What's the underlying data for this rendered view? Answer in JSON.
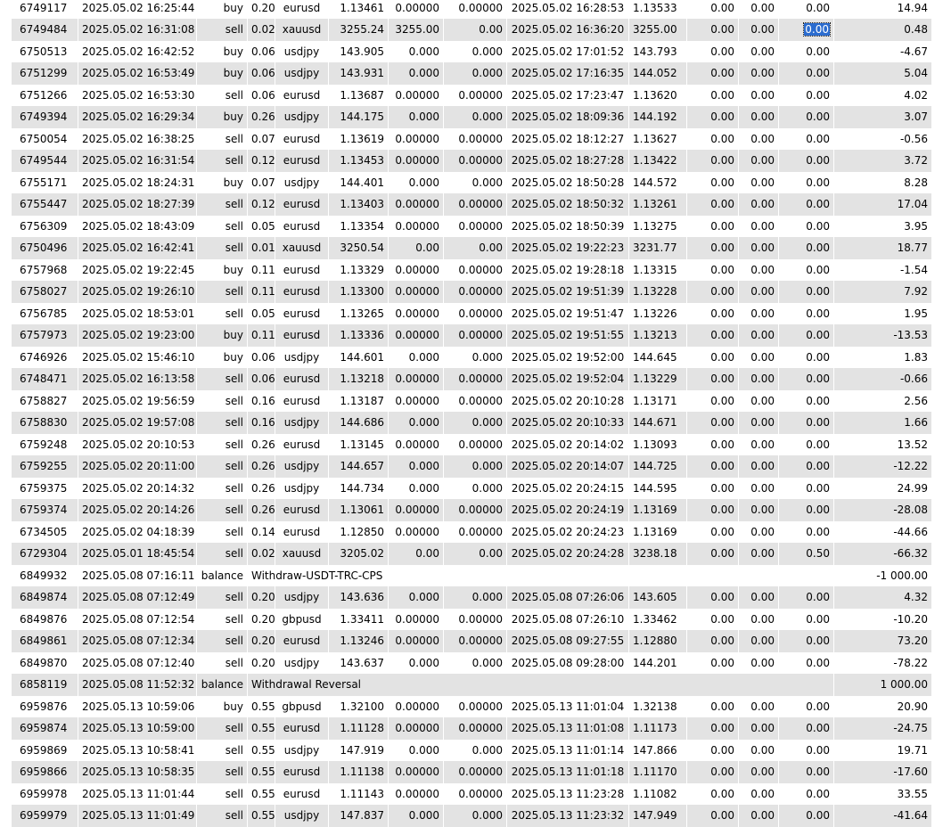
{
  "trade_rows": [
    {
      "ticket": "6749117",
      "open_time": "2025.05.02 16:25:44",
      "type": "buy",
      "size": "0.20",
      "symbol": "eurusd",
      "open_price": "1.13461",
      "sl": "0.00000",
      "tp": "0.00000",
      "close_time": "2025.05.02 16:28:53",
      "close_price": "1.13533",
      "commission": "0.00",
      "taxes": "0.00",
      "swap": "0.00",
      "profit": "14.94"
    },
    {
      "ticket": "6749484",
      "open_time": "2025.05.02 16:31:08",
      "type": "sell",
      "size": "0.02",
      "symbol": "xauusd",
      "open_price": "3255.24",
      "sl": "3255.00",
      "tp": "0.00",
      "close_time": "2025.05.02 16:36:20",
      "close_price": "3255.00",
      "commission": "0.00",
      "taxes": "0.00",
      "swap": "0.00",
      "profit": "0.48",
      "selected": true
    },
    {
      "ticket": "6750513",
      "open_time": "2025.05.02 16:42:52",
      "type": "buy",
      "size": "0.06",
      "symbol": "usdjpy",
      "open_price": "143.905",
      "sl": "0.000",
      "tp": "0.000",
      "close_time": "2025.05.02 17:01:52",
      "close_price": "143.793",
      "commission": "0.00",
      "taxes": "0.00",
      "swap": "0.00",
      "profit": "-4.67"
    },
    {
      "ticket": "6751299",
      "open_time": "2025.05.02 16:53:49",
      "type": "buy",
      "size": "0.06",
      "symbol": "usdjpy",
      "open_price": "143.931",
      "sl": "0.000",
      "tp": "0.000",
      "close_time": "2025.05.02 17:16:35",
      "close_price": "144.052",
      "commission": "0.00",
      "taxes": "0.00",
      "swap": "0.00",
      "profit": "5.04"
    },
    {
      "ticket": "6751266",
      "open_time": "2025.05.02 16:53:30",
      "type": "sell",
      "size": "0.06",
      "symbol": "eurusd",
      "open_price": "1.13687",
      "sl": "0.00000",
      "tp": "0.00000",
      "close_time": "2025.05.02 17:23:47",
      "close_price": "1.13620",
      "commission": "0.00",
      "taxes": "0.00",
      "swap": "0.00",
      "profit": "4.02"
    },
    {
      "ticket": "6749394",
      "open_time": "2025.05.02 16:29:34",
      "type": "buy",
      "size": "0.26",
      "symbol": "usdjpy",
      "open_price": "144.175",
      "sl": "0.000",
      "tp": "0.000",
      "close_time": "2025.05.02 18:09:36",
      "close_price": "144.192",
      "commission": "0.00",
      "taxes": "0.00",
      "swap": "0.00",
      "profit": "3.07"
    },
    {
      "ticket": "6750054",
      "open_time": "2025.05.02 16:38:25",
      "type": "sell",
      "size": "0.07",
      "symbol": "eurusd",
      "open_price": "1.13619",
      "sl": "0.00000",
      "tp": "0.00000",
      "close_time": "2025.05.02 18:12:27",
      "close_price": "1.13627",
      "commission": "0.00",
      "taxes": "0.00",
      "swap": "0.00",
      "profit": "-0.56"
    },
    {
      "ticket": "6749544",
      "open_time": "2025.05.02 16:31:54",
      "type": "sell",
      "size": "0.12",
      "symbol": "eurusd",
      "open_price": "1.13453",
      "sl": "0.00000",
      "tp": "0.00000",
      "close_time": "2025.05.02 18:27:28",
      "close_price": "1.13422",
      "commission": "0.00",
      "taxes": "0.00",
      "swap": "0.00",
      "profit": "3.72"
    },
    {
      "ticket": "6755171",
      "open_time": "2025.05.02 18:24:31",
      "type": "buy",
      "size": "0.07",
      "symbol": "usdjpy",
      "open_price": "144.401",
      "sl": "0.000",
      "tp": "0.000",
      "close_time": "2025.05.02 18:50:28",
      "close_price": "144.572",
      "commission": "0.00",
      "taxes": "0.00",
      "swap": "0.00",
      "profit": "8.28"
    },
    {
      "ticket": "6755447",
      "open_time": "2025.05.02 18:27:39",
      "type": "sell",
      "size": "0.12",
      "symbol": "eurusd",
      "open_price": "1.13403",
      "sl": "0.00000",
      "tp": "0.00000",
      "close_time": "2025.05.02 18:50:32",
      "close_price": "1.13261",
      "commission": "0.00",
      "taxes": "0.00",
      "swap": "0.00",
      "profit": "17.04"
    },
    {
      "ticket": "6756309",
      "open_time": "2025.05.02 18:43:09",
      "type": "sell",
      "size": "0.05",
      "symbol": "eurusd",
      "open_price": "1.13354",
      "sl": "0.00000",
      "tp": "0.00000",
      "close_time": "2025.05.02 18:50:39",
      "close_price": "1.13275",
      "commission": "0.00",
      "taxes": "0.00",
      "swap": "0.00",
      "profit": "3.95"
    },
    {
      "ticket": "6750496",
      "open_time": "2025.05.02 16:42:41",
      "type": "sell",
      "size": "0.01",
      "symbol": "xauusd",
      "open_price": "3250.54",
      "sl": "0.00",
      "tp": "0.00",
      "close_time": "2025.05.02 19:22:23",
      "close_price": "3231.77",
      "commission": "0.00",
      "taxes": "0.00",
      "swap": "0.00",
      "profit": "18.77"
    },
    {
      "ticket": "6757968",
      "open_time": "2025.05.02 19:22:45",
      "type": "buy",
      "size": "0.11",
      "symbol": "eurusd",
      "open_price": "1.13329",
      "sl": "0.00000",
      "tp": "0.00000",
      "close_time": "2025.05.02 19:28:18",
      "close_price": "1.13315",
      "commission": "0.00",
      "taxes": "0.00",
      "swap": "0.00",
      "profit": "-1.54"
    },
    {
      "ticket": "6758027",
      "open_time": "2025.05.02 19:26:10",
      "type": "sell",
      "size": "0.11",
      "symbol": "eurusd",
      "open_price": "1.13300",
      "sl": "0.00000",
      "tp": "0.00000",
      "close_time": "2025.05.02 19:51:39",
      "close_price": "1.13228",
      "commission": "0.00",
      "taxes": "0.00",
      "swap": "0.00",
      "profit": "7.92"
    },
    {
      "ticket": "6756785",
      "open_time": "2025.05.02 18:53:01",
      "type": "sell",
      "size": "0.05",
      "symbol": "eurusd",
      "open_price": "1.13265",
      "sl": "0.00000",
      "tp": "0.00000",
      "close_time": "2025.05.02 19:51:47",
      "close_price": "1.13226",
      "commission": "0.00",
      "taxes": "0.00",
      "swap": "0.00",
      "profit": "1.95"
    },
    {
      "ticket": "6757973",
      "open_time": "2025.05.02 19:23:00",
      "type": "buy",
      "size": "0.11",
      "symbol": "eurusd",
      "open_price": "1.13336",
      "sl": "0.00000",
      "tp": "0.00000",
      "close_time": "2025.05.02 19:51:55",
      "close_price": "1.13213",
      "commission": "0.00",
      "taxes": "0.00",
      "swap": "0.00",
      "profit": "-13.53"
    },
    {
      "ticket": "6746926",
      "open_time": "2025.05.02 15:46:10",
      "type": "buy",
      "size": "0.06",
      "symbol": "usdjpy",
      "open_price": "144.601",
      "sl": "0.000",
      "tp": "0.000",
      "close_time": "2025.05.02 19:52:00",
      "close_price": "144.645",
      "commission": "0.00",
      "taxes": "0.00",
      "swap": "0.00",
      "profit": "1.83"
    },
    {
      "ticket": "6748471",
      "open_time": "2025.05.02 16:13:58",
      "type": "sell",
      "size": "0.06",
      "symbol": "eurusd",
      "open_price": "1.13218",
      "sl": "0.00000",
      "tp": "0.00000",
      "close_time": "2025.05.02 19:52:04",
      "close_price": "1.13229",
      "commission": "0.00",
      "taxes": "0.00",
      "swap": "0.00",
      "profit": "-0.66"
    },
    {
      "ticket": "6758827",
      "open_time": "2025.05.02 19:56:59",
      "type": "sell",
      "size": "0.16",
      "symbol": "eurusd",
      "open_price": "1.13187",
      "sl": "0.00000",
      "tp": "0.00000",
      "close_time": "2025.05.02 20:10:28",
      "close_price": "1.13171",
      "commission": "0.00",
      "taxes": "0.00",
      "swap": "0.00",
      "profit": "2.56"
    },
    {
      "ticket": "6758830",
      "open_time": "2025.05.02 19:57:08",
      "type": "sell",
      "size": "0.16",
      "symbol": "usdjpy",
      "open_price": "144.686",
      "sl": "0.000",
      "tp": "0.000",
      "close_time": "2025.05.02 20:10:33",
      "close_price": "144.671",
      "commission": "0.00",
      "taxes": "0.00",
      "swap": "0.00",
      "profit": "1.66"
    },
    {
      "ticket": "6759248",
      "open_time": "2025.05.02 20:10:53",
      "type": "sell",
      "size": "0.26",
      "symbol": "eurusd",
      "open_price": "1.13145",
      "sl": "0.00000",
      "tp": "0.00000",
      "close_time": "2025.05.02 20:14:02",
      "close_price": "1.13093",
      "commission": "0.00",
      "taxes": "0.00",
      "swap": "0.00",
      "profit": "13.52"
    },
    {
      "ticket": "6759255",
      "open_time": "2025.05.02 20:11:00",
      "type": "sell",
      "size": "0.26",
      "symbol": "usdjpy",
      "open_price": "144.657",
      "sl": "0.000",
      "tp": "0.000",
      "close_time": "2025.05.02 20:14:07",
      "close_price": "144.725",
      "commission": "0.00",
      "taxes": "0.00",
      "swap": "0.00",
      "profit": "-12.22"
    },
    {
      "ticket": "6759375",
      "open_time": "2025.05.02 20:14:32",
      "type": "sell",
      "size": "0.26",
      "symbol": "usdjpy",
      "open_price": "144.734",
      "sl": "0.000",
      "tp": "0.000",
      "close_time": "2025.05.02 20:24:15",
      "close_price": "144.595",
      "commission": "0.00",
      "taxes": "0.00",
      "swap": "0.00",
      "profit": "24.99"
    },
    {
      "ticket": "6759374",
      "open_time": "2025.05.02 20:14:26",
      "type": "sell",
      "size": "0.26",
      "symbol": "eurusd",
      "open_price": "1.13061",
      "sl": "0.00000",
      "tp": "0.00000",
      "close_time": "2025.05.02 20:24:19",
      "close_price": "1.13169",
      "commission": "0.00",
      "taxes": "0.00",
      "swap": "0.00",
      "profit": "-28.08"
    },
    {
      "ticket": "6734505",
      "open_time": "2025.05.02 04:18:39",
      "type": "sell",
      "size": "0.14",
      "symbol": "eurusd",
      "open_price": "1.12850",
      "sl": "0.00000",
      "tp": "0.00000",
      "close_time": "2025.05.02 20:24:23",
      "close_price": "1.13169",
      "commission": "0.00",
      "taxes": "0.00",
      "swap": "0.00",
      "profit": "-44.66"
    },
    {
      "ticket": "6729304",
      "open_time": "2025.05.01 18:45:54",
      "type": "sell",
      "size": "0.02",
      "symbol": "xauusd",
      "open_price": "3205.02",
      "sl": "0.00",
      "tp": "0.00",
      "close_time": "2025.05.02 20:24:28",
      "close_price": "3238.18",
      "commission": "0.00",
      "taxes": "0.00",
      "swap": "0.50",
      "profit": "-66.32"
    },
    {
      "ticket": "6849932",
      "open_time": "2025.05.08 07:16:11",
      "type": "balance",
      "comment": "Withdraw-USDT-TRC-CPS",
      "profit": "-1 000.00"
    },
    {
      "ticket": "6849874",
      "open_time": "2025.05.08 07:12:49",
      "type": "sell",
      "size": "0.20",
      "symbol": "usdjpy",
      "open_price": "143.636",
      "sl": "0.000",
      "tp": "0.000",
      "close_time": "2025.05.08 07:26:06",
      "close_price": "143.605",
      "commission": "0.00",
      "taxes": "0.00",
      "swap": "0.00",
      "profit": "4.32"
    },
    {
      "ticket": "6849876",
      "open_time": "2025.05.08 07:12:54",
      "type": "sell",
      "size": "0.20",
      "symbol": "gbpusd",
      "open_price": "1.33411",
      "sl": "0.00000",
      "tp": "0.00000",
      "close_time": "2025.05.08 07:26:10",
      "close_price": "1.33462",
      "commission": "0.00",
      "taxes": "0.00",
      "swap": "0.00",
      "profit": "-10.20"
    },
    {
      "ticket": "6849861",
      "open_time": "2025.05.08 07:12:34",
      "type": "sell",
      "size": "0.20",
      "symbol": "eurusd",
      "open_price": "1.13246",
      "sl": "0.00000",
      "tp": "0.00000",
      "close_time": "2025.05.08 09:27:55",
      "close_price": "1.12880",
      "commission": "0.00",
      "taxes": "0.00",
      "swap": "0.00",
      "profit": "73.20"
    },
    {
      "ticket": "6849870",
      "open_time": "2025.05.08 07:12:40",
      "type": "sell",
      "size": "0.20",
      "symbol": "usdjpy",
      "open_price": "143.637",
      "sl": "0.000",
      "tp": "0.000",
      "close_time": "2025.05.08 09:28:00",
      "close_price": "144.201",
      "commission": "0.00",
      "taxes": "0.00",
      "swap": "0.00",
      "profit": "-78.22"
    },
    {
      "ticket": "6858119",
      "open_time": "2025.05.08 11:52:32",
      "type": "balance",
      "comment": "Withdrawal Reversal",
      "profit": "1 000.00"
    },
    {
      "ticket": "6959876",
      "open_time": "2025.05.13 10:59:06",
      "type": "buy",
      "size": "0.55",
      "symbol": "gbpusd",
      "open_price": "1.32100",
      "sl": "0.00000",
      "tp": "0.00000",
      "close_time": "2025.05.13 11:01:04",
      "close_price": "1.32138",
      "commission": "0.00",
      "taxes": "0.00",
      "swap": "0.00",
      "profit": "20.90"
    },
    {
      "ticket": "6959874",
      "open_time": "2025.05.13 10:59:00",
      "type": "sell",
      "size": "0.55",
      "symbol": "eurusd",
      "open_price": "1.11128",
      "sl": "0.00000",
      "tp": "0.00000",
      "close_time": "2025.05.13 11:01:08",
      "close_price": "1.11173",
      "commission": "0.00",
      "taxes": "0.00",
      "swap": "0.00",
      "profit": "-24.75"
    },
    {
      "ticket": "6959869",
      "open_time": "2025.05.13 10:58:41",
      "type": "sell",
      "size": "0.55",
      "symbol": "usdjpy",
      "open_price": "147.919",
      "sl": "0.000",
      "tp": "0.000",
      "close_time": "2025.05.13 11:01:14",
      "close_price": "147.866",
      "commission": "0.00",
      "taxes": "0.00",
      "swap": "0.00",
      "profit": "19.71"
    },
    {
      "ticket": "6959866",
      "open_time": "2025.05.13 10:58:35",
      "type": "sell",
      "size": "0.55",
      "symbol": "eurusd",
      "open_price": "1.11138",
      "sl": "0.00000",
      "tp": "0.00000",
      "close_time": "2025.05.13 11:01:18",
      "close_price": "1.11170",
      "commission": "0.00",
      "taxes": "0.00",
      "swap": "0.00",
      "profit": "-17.60"
    },
    {
      "ticket": "6959978",
      "open_time": "2025.05.13 11:01:44",
      "type": "sell",
      "size": "0.55",
      "symbol": "eurusd",
      "open_price": "1.11143",
      "sl": "0.00000",
      "tp": "0.00000",
      "close_time": "2025.05.13 11:23:28",
      "close_price": "1.11082",
      "commission": "0.00",
      "taxes": "0.00",
      "swap": "0.00",
      "profit": "33.55"
    },
    {
      "ticket": "6959979",
      "open_time": "2025.05.13 11:01:49",
      "type": "sell",
      "size": "0.55",
      "symbol": "usdjpy",
      "open_price": "147.837",
      "sl": "0.000",
      "tp": "0.000",
      "close_time": "2025.05.13 11:23:32",
      "close_price": "147.949",
      "commission": "0.00",
      "taxes": "0.00",
      "swap": "0.00",
      "profit": "-41.64"
    }
  ],
  "colors": {
    "row_shade": "#e3e3e3",
    "row_plain": "#ffffff",
    "selection": "#2b6ccf"
  }
}
